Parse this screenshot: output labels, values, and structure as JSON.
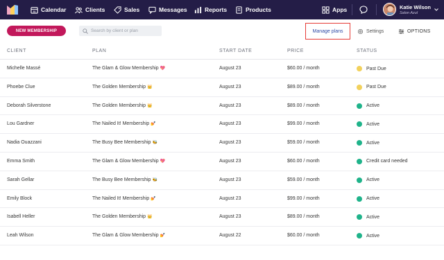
{
  "nav": {
    "items": [
      {
        "label": "Calendar",
        "icon": "calendar-icon"
      },
      {
        "label": "Clients",
        "icon": "clients-icon"
      },
      {
        "label": "Sales",
        "icon": "tag-icon"
      },
      {
        "label": "Messages",
        "icon": "messages-icon"
      },
      {
        "label": "Reports",
        "icon": "reports-icon"
      },
      {
        "label": "Products",
        "icon": "products-icon"
      }
    ],
    "apps_label": "Apps",
    "user_name": "Katie Wilson",
    "user_salon": "Salon Azul"
  },
  "toolbar": {
    "new_button_label": "NEW MEMBERSHIP",
    "search_placeholder": "Search by client or plan",
    "manage_plans_label": "Manage plans",
    "settings_label": "Settings",
    "options_label": "OPTIONS"
  },
  "table": {
    "headers": {
      "client": "CLIENT",
      "plan": "PLAN",
      "start_date": "START DATE",
      "price": "PRICE",
      "status": "STATUS"
    },
    "rows": [
      {
        "client": "Michelle Massé",
        "plan": "The Glam & Glow Membership",
        "emoji": "💖",
        "start_date": "August 23",
        "price": "$60.00 / month",
        "status": "Past Due",
        "status_color": "#f2d15c"
      },
      {
        "client": "Phoebe Clue",
        "plan": "The Golden Membership",
        "emoji": "👑",
        "start_date": "August 23",
        "price": "$89.00 / month",
        "status": "Past Due",
        "status_color": "#f2d15c"
      },
      {
        "client": "Deborah Silverstone",
        "plan": "The Golden Membership",
        "emoji": "👑",
        "start_date": "August 23",
        "price": "$89.00 / month",
        "status": "Active",
        "status_color": "#1fb38a"
      },
      {
        "client": "Lou Gardner",
        "plan": "The Nailed It! Membership",
        "emoji": "💅",
        "start_date": "August 23",
        "price": "$99.00 / month",
        "status": "Active",
        "status_color": "#1fb38a"
      },
      {
        "client": "Nadia Ouazzani",
        "plan": "The Busy Bee Membership",
        "emoji": "🐝",
        "start_date": "August 23",
        "price": "$59.00 / month",
        "status": "Active",
        "status_color": "#1fb38a"
      },
      {
        "client": "Emma Smith",
        "plan": "The Glam & Glow Membership",
        "emoji": "💖",
        "start_date": "August 23",
        "price": "$60.00 / month",
        "status": "Credit card needed",
        "status_color": "#1fb38a"
      },
      {
        "client": "Sarah Gellar",
        "plan": "The Busy Bee Membership",
        "emoji": "🐝",
        "start_date": "August 23",
        "price": "$59.00 / month",
        "status": "Active",
        "status_color": "#1fb38a"
      },
      {
        "client": "Emily Block",
        "plan": "The Nailed It! Membership",
        "emoji": "💅",
        "start_date": "August 23",
        "price": "$99.00 / month",
        "status": "Active",
        "status_color": "#1fb38a"
      },
      {
        "client": "Isabell Heller",
        "plan": "The Golden Membership",
        "emoji": "👑",
        "start_date": "August 23",
        "price": "$89.00 / month",
        "status": "Active",
        "status_color": "#1fb38a"
      },
      {
        "client": "Leah Wilson",
        "plan": "The Glam & Glow Membership",
        "emoji": "💅",
        "start_date": "August 22",
        "price": "$60.00 / month",
        "status": "Active",
        "status_color": "#1fb38a"
      }
    ]
  },
  "colors": {
    "nav_bg": "#241d47",
    "accent": "#c2185b",
    "link": "#2f4aa6",
    "highlight_border": "#e53935",
    "active": "#1fb38a",
    "past_due": "#f2d15c"
  }
}
